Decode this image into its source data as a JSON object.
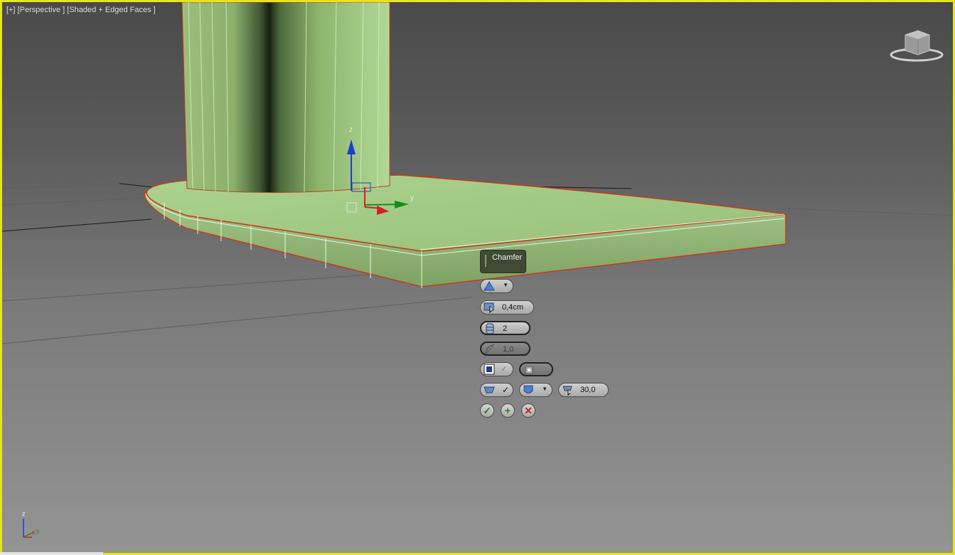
{
  "viewport": {
    "label": "[+] [Perspective ] [Shaded + Edged Faces ]",
    "border_color": "#e8e31f",
    "viewcube_icon": "viewcube-icon",
    "gizmo_axes": {
      "z": "z",
      "y": "y"
    },
    "corner_axes": {
      "z": "z",
      "x": "x",
      "y": "y"
    }
  },
  "caddy": {
    "title": "Chamfer",
    "chamfer_type_icon": "triangle-icon",
    "amount": "0,4cm",
    "segments": "2",
    "tension": "1,0",
    "smooth_threshold": "30,0",
    "ok_icon": "check-icon",
    "apply_icon": "plus-icon",
    "cancel_icon": "x-icon"
  },
  "colors": {
    "object_green": "#a8d08a",
    "selection_edge": "#c83a1c",
    "gizmo_x": "#d42020",
    "gizmo_y": "#1a8c1a",
    "gizmo_z": "#1a3fd0"
  }
}
